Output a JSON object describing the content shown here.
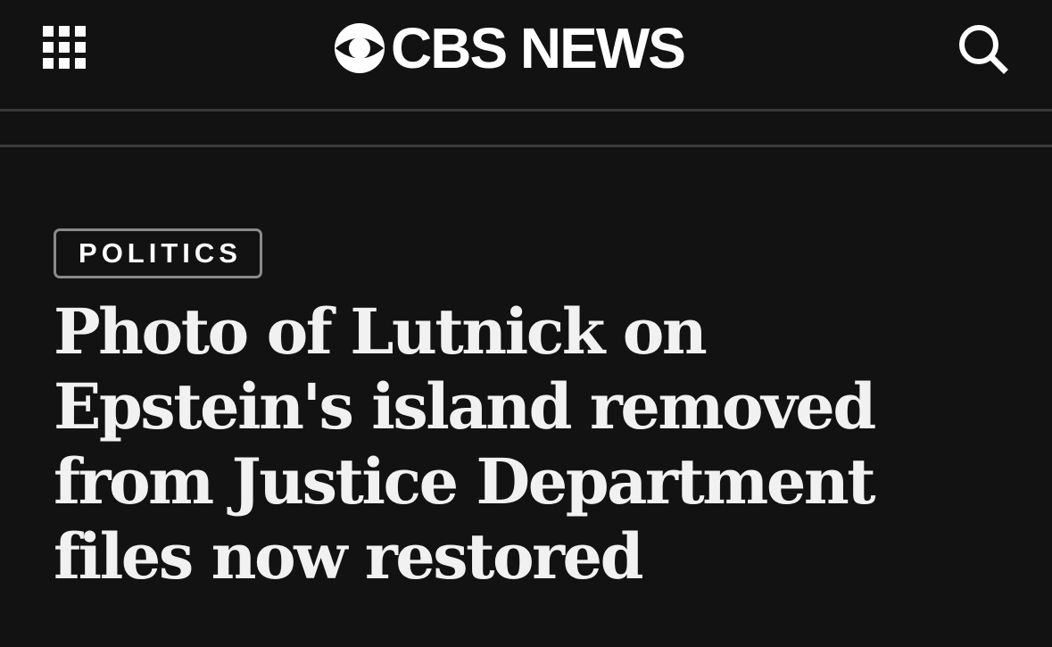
{
  "header": {
    "menu_icon": "grid-menu-icon",
    "logo_icon": "cbs-eye-icon",
    "logo_text": "CBS NEWS",
    "search_icon": "search-icon"
  },
  "article": {
    "category": "POLITICS",
    "headline": "Photo of Lutnick on Epstein's island removed from Justice Department files now restored"
  },
  "colors": {
    "background": "#121212",
    "text": "#f1f1f1",
    "badge_border": "#8a8a8a",
    "divider": "#3a3a3a"
  }
}
